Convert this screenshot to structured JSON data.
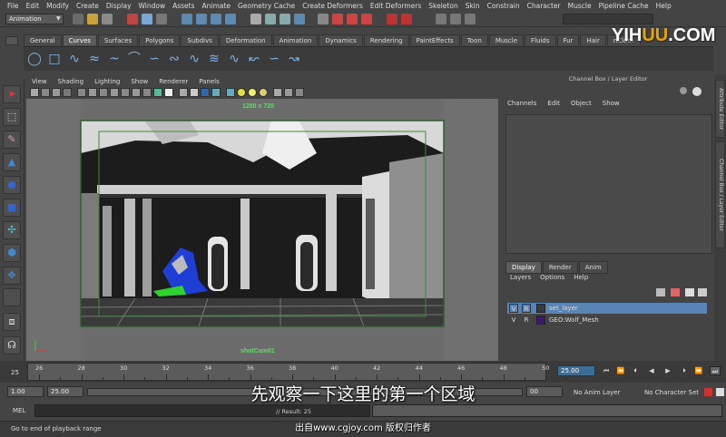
{
  "menubar": {
    "items": [
      "File",
      "Edit",
      "Modify",
      "Create",
      "Display",
      "Window",
      "Assets",
      "Animate",
      "Geometry Cache",
      "Create Deformers",
      "Edit Deformers",
      "Skeleton",
      "Skin",
      "Constrain",
      "Character",
      "Muscle",
      "Pipeline Cache",
      "Help"
    ]
  },
  "status_line": {
    "mode": "Animation"
  },
  "shelf": {
    "tabs": [
      "General",
      "Curves",
      "Surfaces",
      "Polygons",
      "Subdivs",
      "Deformation",
      "Animation",
      "Dynamics",
      "Rendering",
      "PaintEffects",
      "Toon",
      "Muscle",
      "Fluids",
      "Fur",
      "Hair",
      "nCloth"
    ],
    "active_tab": "Curves"
  },
  "panel": {
    "menu": [
      "View",
      "Shading",
      "Lighting",
      "Show",
      "Renderer",
      "Panels"
    ],
    "resolution_gate": "1280 x 720",
    "camera_name": "shotCam01"
  },
  "channel_box": {
    "title": "Channel Box / Layer Editor",
    "menu": [
      "Channels",
      "Edit",
      "Object",
      "Show"
    ]
  },
  "layer_editor": {
    "tabs": [
      "Display",
      "Render",
      "Anim"
    ],
    "active_tab": "Display",
    "menu": [
      "Layers",
      "Options",
      "Help"
    ],
    "layers": [
      {
        "v": "V",
        "r": "R",
        "name": "set_layer",
        "selected": true,
        "color": "#3a3a3a"
      },
      {
        "v": "V",
        "r": "R",
        "name": "GEO:Wolf_Mesh",
        "selected": false,
        "color": "#3b1a6e"
      }
    ]
  },
  "side_tabs": [
    "Attribute Editor",
    "Channel Box / Layer Editor"
  ],
  "timeline": {
    "ticks": [
      "26",
      "28",
      "30",
      "32",
      "34",
      "36",
      "38",
      "40",
      "42",
      "44",
      "46",
      "48",
      "50"
    ],
    "start_label": "25",
    "current_frame": "25.00"
  },
  "range_slider": {
    "start": "1.00",
    "inner_start": "25.00",
    "end": "00",
    "anim_layer": "No Anim Layer",
    "character_set": "No Character Set"
  },
  "command_line": {
    "label": "MEL",
    "result": "// Result: 25"
  },
  "help_line": {
    "text": "Go to end of playback range"
  },
  "subtitle": "先观察一下这里的第一个区域",
  "credit": "出自www.cgjoy.com 版权归作者",
  "watermark": {
    "prefix": "YIH",
    "highlight": "UU",
    "suffix": ".COM"
  },
  "colors": {
    "accent_hud": "#6dd36d",
    "current_frame_bg": "#3c6d94",
    "layer_selected": "#5a84b4"
  }
}
